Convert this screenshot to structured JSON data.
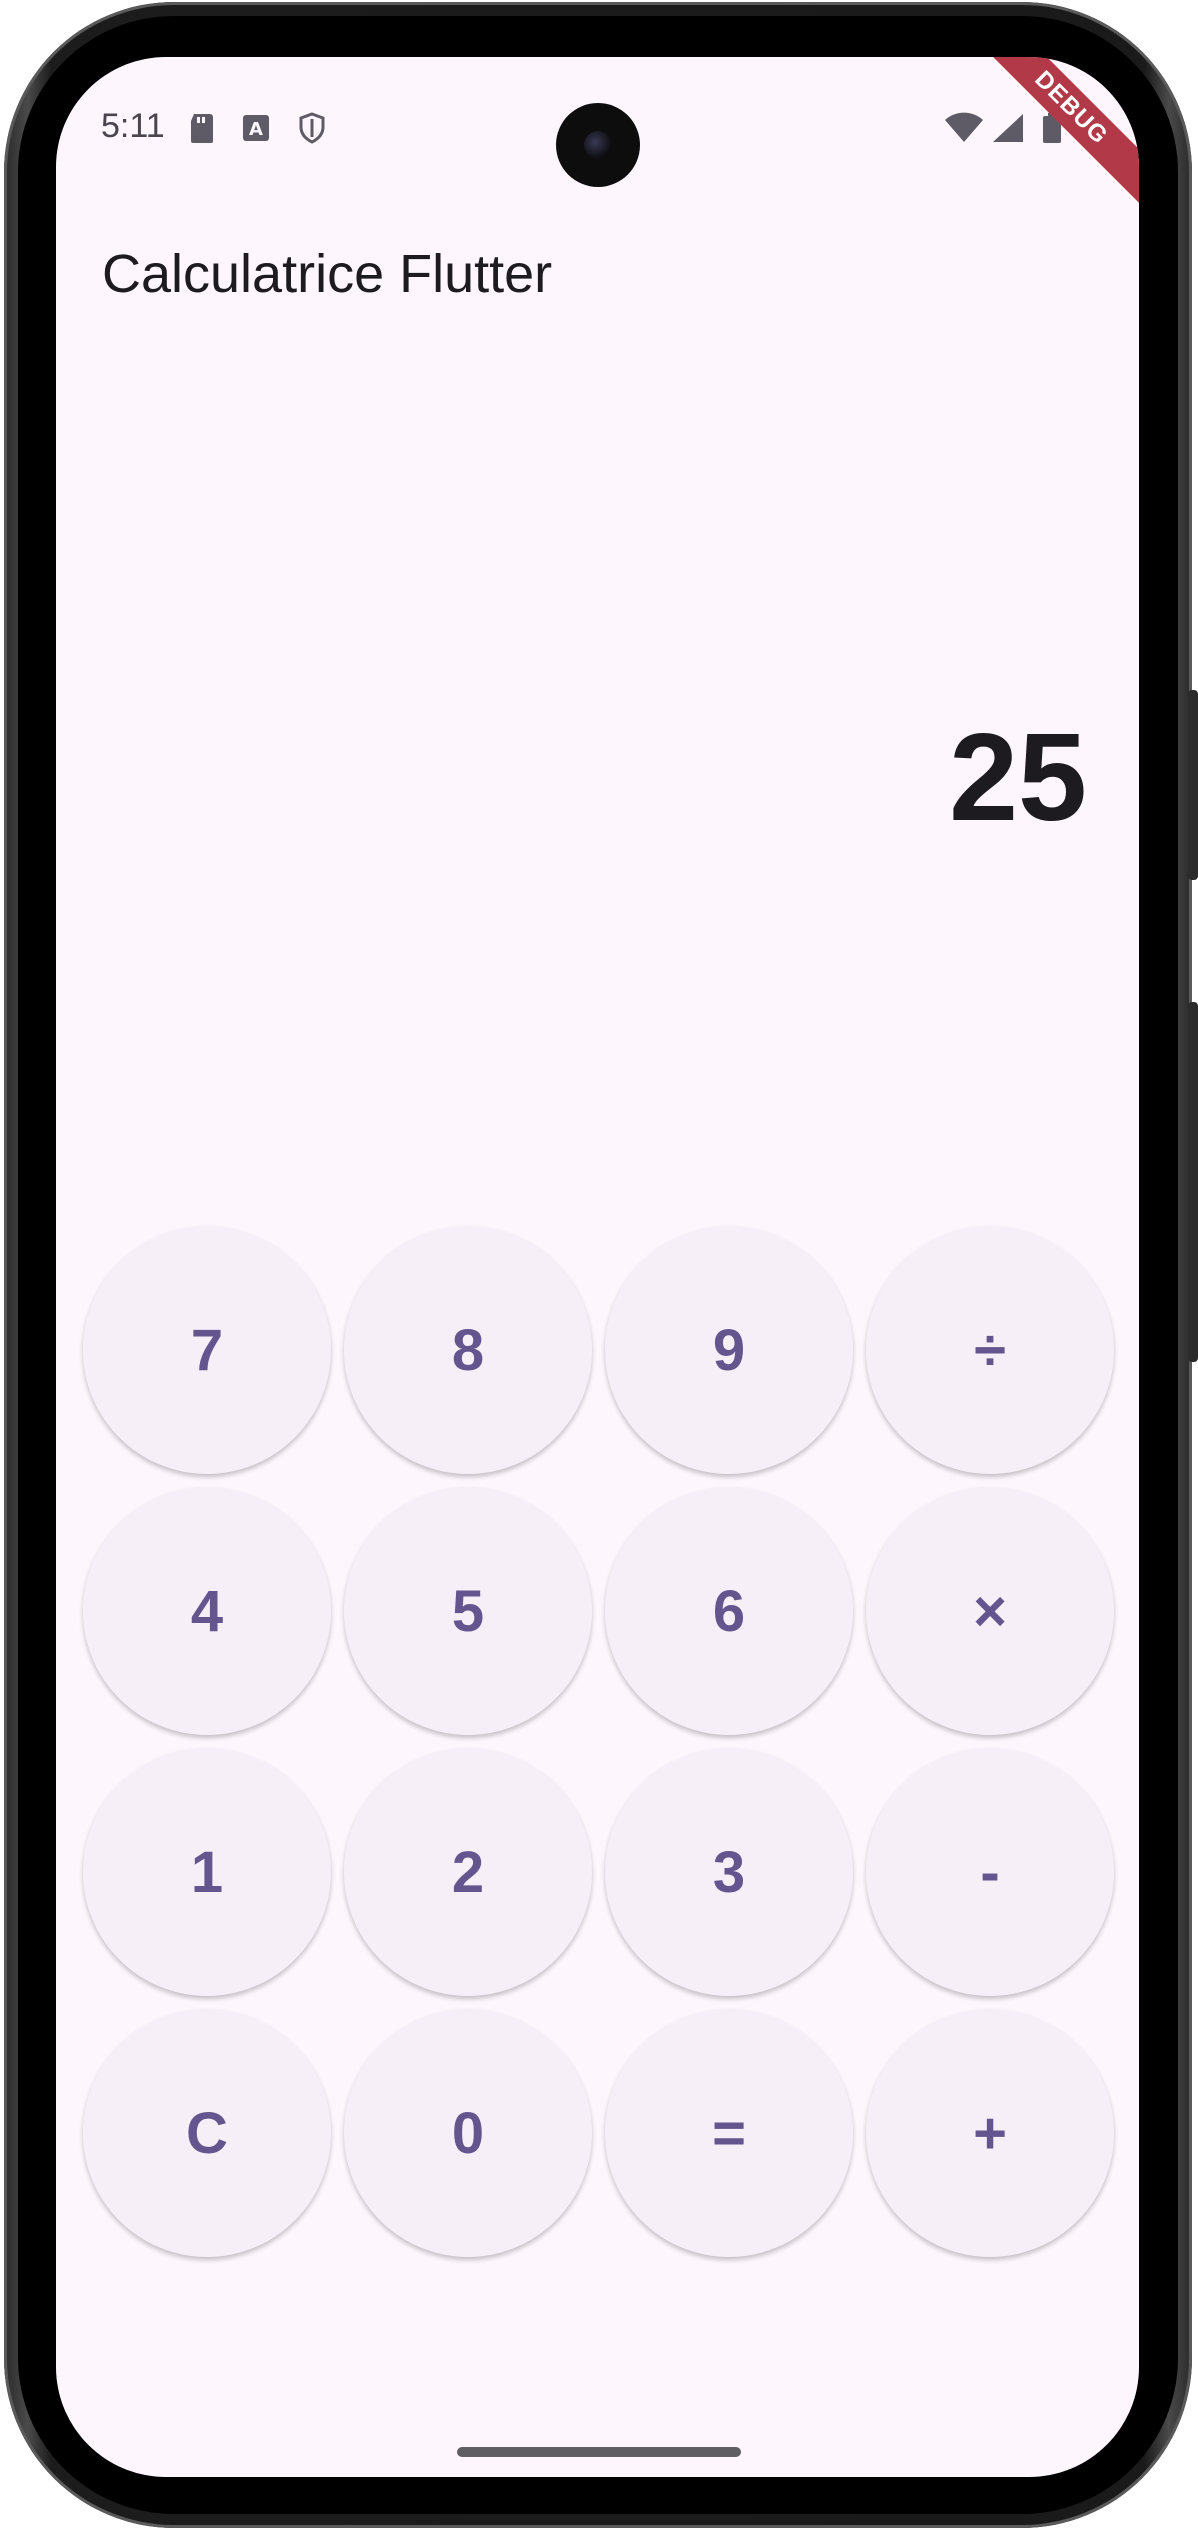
{
  "status_bar": {
    "time": "5:11",
    "left_icons": [
      "sd-card-icon",
      "text-a-icon",
      "shield-icon"
    ],
    "right_icons": [
      "wifi-icon",
      "signal-icon",
      "battery-icon"
    ]
  },
  "debug_banner": "DEBUG",
  "app_bar": {
    "title": "Calculatrice Flutter"
  },
  "display": {
    "value": "25"
  },
  "keypad": {
    "keys": [
      "7",
      "8",
      "9",
      "÷",
      "4",
      "5",
      "6",
      "×",
      "1",
      "2",
      "3",
      "-",
      "C",
      "0",
      "=",
      "+"
    ]
  },
  "colors": {
    "background": "#fdf7fd",
    "key_background": "#f6eff7",
    "key_text": "#65558f",
    "display_text": "#1d1b20",
    "debug_banner": "#b23a48"
  }
}
